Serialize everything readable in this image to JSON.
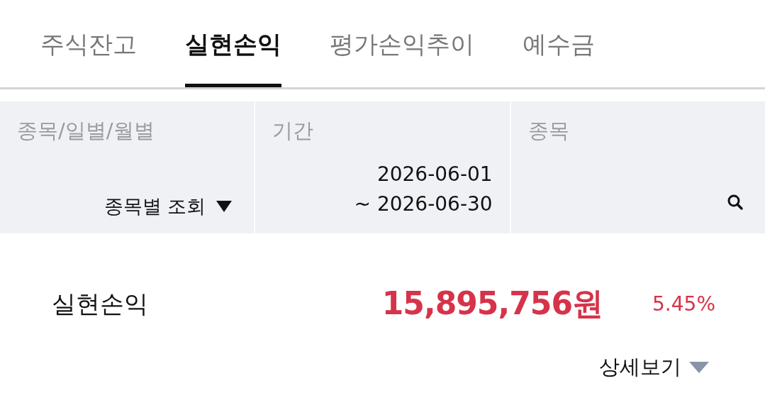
{
  "tabs": [
    {
      "label": "주식잔고",
      "selected": false
    },
    {
      "label": "실현손익",
      "selected": true
    },
    {
      "label": "평가손익추이",
      "selected": false
    },
    {
      "label": "예수금",
      "selected": false
    }
  ],
  "filters": [
    {
      "kind": "dropdown",
      "label": "종목/일별/월별",
      "value": "종목별 조회"
    },
    {
      "kind": "date_range",
      "label": "기간",
      "start": "2026-06-01",
      "end": "~ 2026-06-30"
    },
    {
      "kind": "search",
      "label": "종목"
    }
  ],
  "summary": {
    "label": "실현손익",
    "amount": "15,895,756원",
    "rate": "5.45%"
  },
  "detail_toggle": {
    "label": "상세보기",
    "expanded": false
  }
}
